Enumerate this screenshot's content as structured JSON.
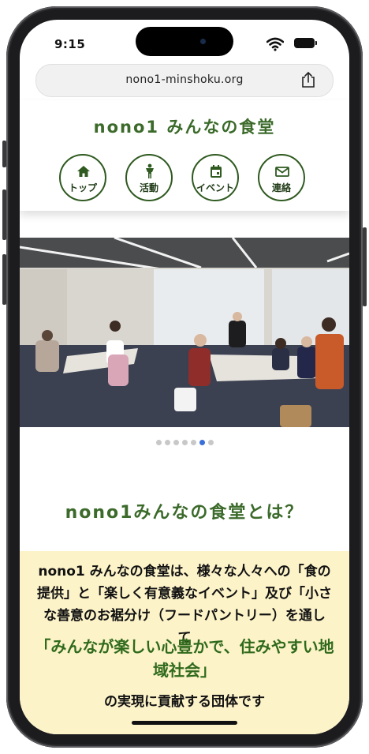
{
  "status": {
    "time": "9:15"
  },
  "browser": {
    "url": "nono1-minshoku.org"
  },
  "site": {
    "title": "nono1 みんなの食堂"
  },
  "nav": [
    {
      "label": "トップ",
      "icon": "home-icon"
    },
    {
      "label": "活動",
      "icon": "person-icon"
    },
    {
      "label": "イベント",
      "icon": "calendar-icon"
    },
    {
      "label": "連絡",
      "icon": "mail-icon"
    }
  ],
  "carousel": {
    "slide_count": 7,
    "active_index": 5
  },
  "about": {
    "heading": "nono1みんなの食堂とは？",
    "text": "nono1 みんなの食堂は、様々な人々への「食の提供」と「楽しく有意義なイベント」及び「小さな善意のお裾分け（フードパントリー）を通して",
    "highlight": "「みんなが楽しい心豊かで、住みやすい地域社会」",
    "tail": "の実現に貢献する団体です"
  },
  "colors": {
    "brand_green": "#3b6a2a",
    "highlight_bg": "#fdf3c9",
    "active_dot": "#3a6fd9"
  }
}
